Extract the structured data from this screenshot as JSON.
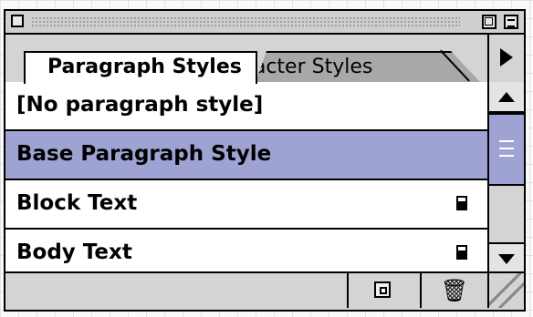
{
  "palette": {
    "tabs": [
      {
        "label": "Paragraph Styles",
        "active": true
      },
      {
        "label": "Character Styles",
        "active": false
      }
    ],
    "styles": [
      {
        "name": "[No paragraph style]",
        "selected": false,
        "has_icon": false
      },
      {
        "name": "Base Paragraph Style",
        "selected": true,
        "has_icon": false
      },
      {
        "name": "Block Text",
        "selected": false,
        "has_icon": true
      },
      {
        "name": "Body Text",
        "selected": false,
        "has_icon": true
      }
    ],
    "bottom": {
      "delete_glyph": "🗑"
    },
    "icons": {
      "close": "close-box-icon",
      "zoom": "zoom-box-icon",
      "collapse": "collapse-box-icon",
      "menu": "palette-menu-triangle-icon",
      "new_style": "new-style-icon",
      "delete": "trash-icon",
      "resize": "resize-grip-icon"
    },
    "colors": {
      "selection": "#9fa3d3",
      "chrome": "#d4d4d4"
    }
  }
}
